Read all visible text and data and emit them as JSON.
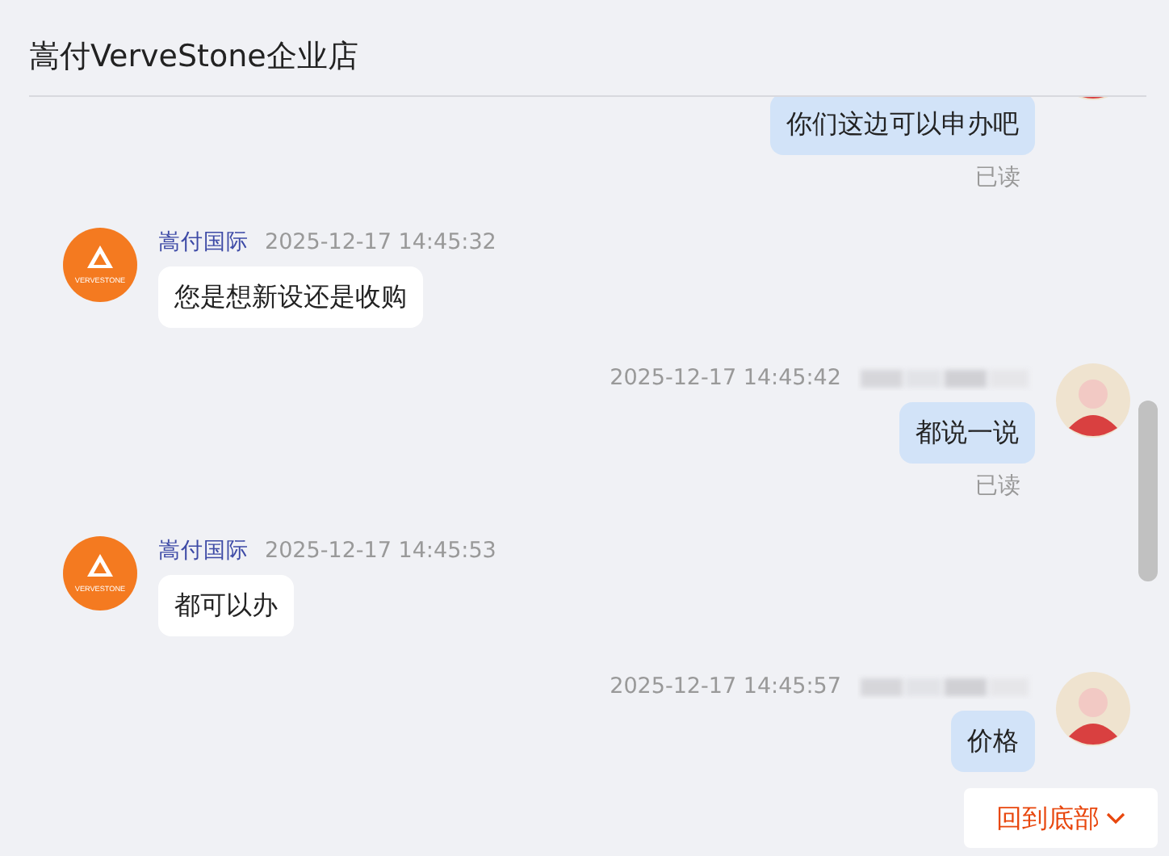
{
  "header": {
    "title": "嵩付VerveStone企业店"
  },
  "messages": [
    {
      "kind": "outgoing",
      "avatar_cut": true,
      "text": "你们这边可以申办吧",
      "read_label": "已读"
    },
    {
      "kind": "incoming",
      "name": "嵩付国际",
      "logo_text": "VERVESTONE",
      "time": "2025-12-17 14:45:32",
      "text": "您是想新设还是收购"
    },
    {
      "kind": "outgoing",
      "name_blurred": true,
      "time": "2025-12-17 14:45:42",
      "text": "都说一说",
      "read_label": "已读"
    },
    {
      "kind": "incoming",
      "name": "嵩付国际",
      "logo_text": "VERVESTONE",
      "time": "2025-12-17 14:45:53",
      "text": "都可以办"
    },
    {
      "kind": "outgoing",
      "name_blurred": true,
      "time": "2025-12-17 14:45:57",
      "text": "价格"
    }
  ],
  "jump_button": {
    "label": "回到底部"
  }
}
